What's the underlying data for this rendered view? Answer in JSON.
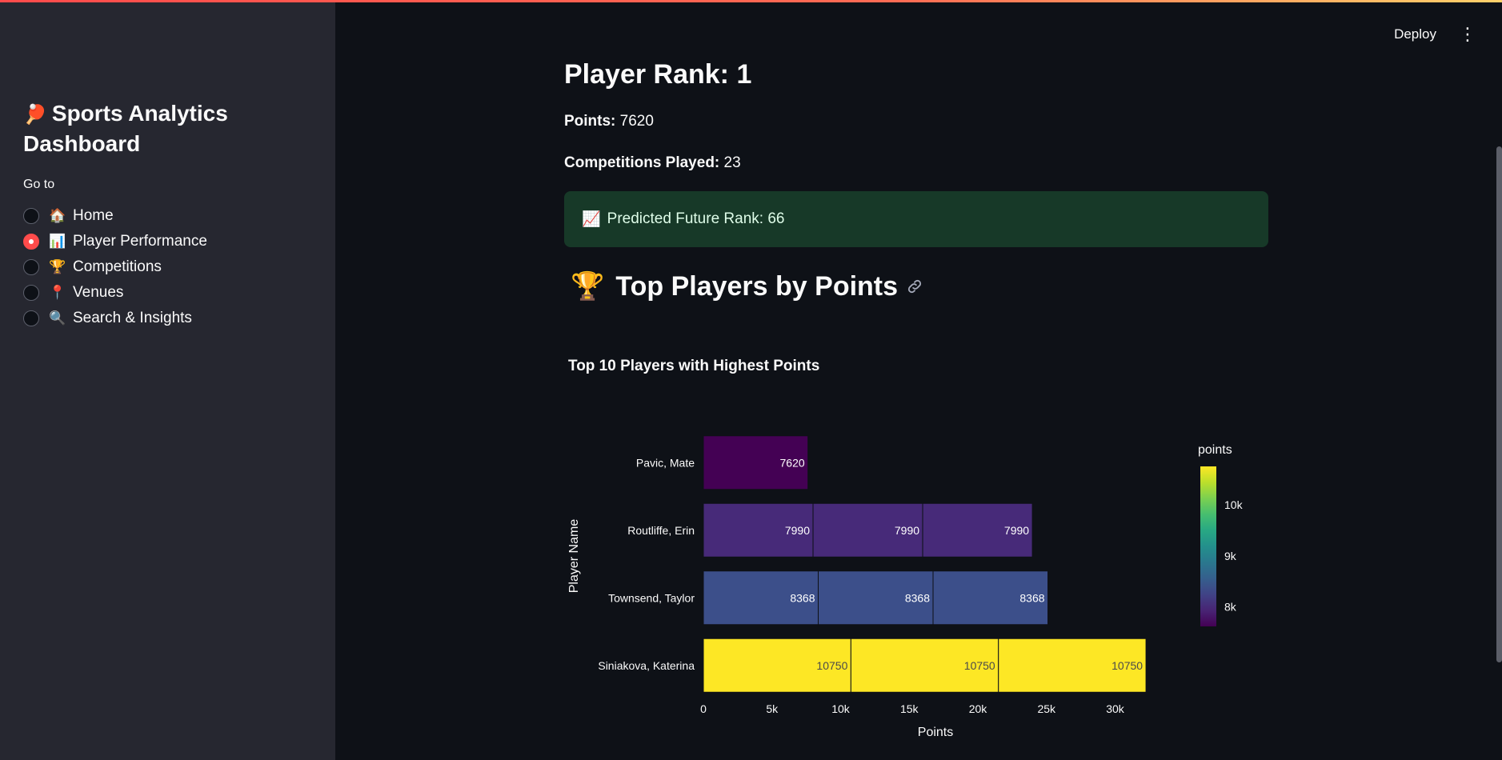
{
  "sidebar": {
    "title_emoji": "🏓",
    "title": "Sports Analytics Dashboard",
    "goto_label": "Go to",
    "items": [
      {
        "emoji": "🏠",
        "label": "Home",
        "checked": false
      },
      {
        "emoji": "📊",
        "label": "Player Performance",
        "checked": true
      },
      {
        "emoji": "🏆",
        "label": "Competitions",
        "checked": false
      },
      {
        "emoji": "📍",
        "label": "Venues",
        "checked": false
      },
      {
        "emoji": "🔍",
        "label": "Search & Insights",
        "checked": false
      }
    ]
  },
  "header": {
    "deploy_label": "Deploy",
    "menu_icon": "⋮"
  },
  "main": {
    "rank_heading": "Player Rank: 1",
    "points_label": "Points:",
    "points_value": "7620",
    "competitions_label": "Competitions Played:",
    "competitions_value": "23",
    "prediction_emoji": "📈",
    "prediction_text": "Predicted Future Rank: 66",
    "top_heading_emoji": "🏆",
    "top_heading": "Top Players by Points"
  },
  "chart_data": {
    "type": "bar",
    "orientation": "horizontal",
    "stacked": true,
    "title": "Top 10 Players with Highest Points",
    "xlabel": "Points",
    "ylabel": "Player Name",
    "xlim": [
      0,
      32500
    ],
    "xticks": [
      0,
      5000,
      10000,
      15000,
      20000,
      25000,
      30000
    ],
    "xtick_labels": [
      "0",
      "5k",
      "10k",
      "15k",
      "20k",
      "25k",
      "30k"
    ],
    "colorbar": {
      "title": "points",
      "min": 7620,
      "max": 10750,
      "ticks": [
        8000,
        9000,
        10000
      ],
      "tick_labels": [
        "8k",
        "9k",
        "10k"
      ],
      "colorscale": "viridis"
    },
    "categories": [
      "Pavic, Mate",
      "Routliffe, Erin",
      "Townsend, Taylor",
      "Siniakova, Katerina"
    ],
    "segments": [
      [
        7620
      ],
      [
        7990,
        7990,
        7990
      ],
      [
        8368,
        8368,
        8368
      ],
      [
        10750,
        10750,
        10750
      ]
    ]
  }
}
